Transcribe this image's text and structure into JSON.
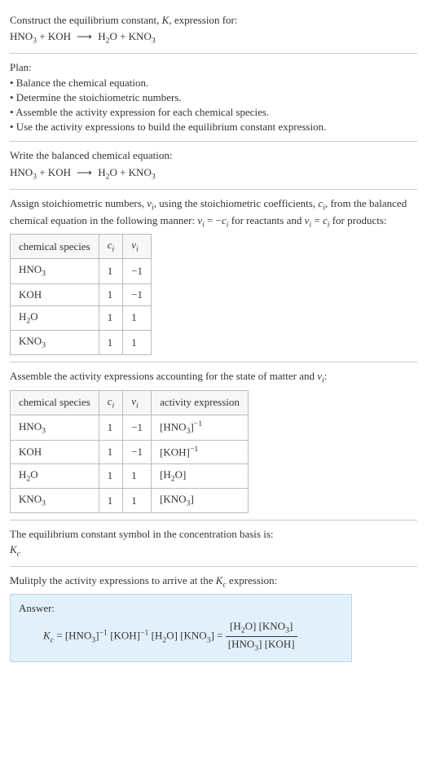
{
  "prompt": {
    "line1_pre": "Construct the equilibrium constant, ",
    "line1_K": "K",
    "line1_post": ", expression for:",
    "eq_lhs1": "HNO",
    "eq_lhs1_sub": "3",
    "eq_plus1": " + KOH ",
    "eq_arrow": "⟶",
    "eq_rhs1": " H",
    "eq_rhs1_sub": "2",
    "eq_rhs2": "O + KNO",
    "eq_rhs2_sub": "3"
  },
  "plan": {
    "title": "Plan:",
    "b1": "• Balance the chemical equation.",
    "b2": "• Determine the stoichiometric numbers.",
    "b3": "• Assemble the activity expression for each chemical species.",
    "b4": "• Use the activity expressions to build the equilibrium constant expression."
  },
  "balanced": {
    "title": "Write the balanced chemical equation:"
  },
  "stoich": {
    "pre": "Assign stoichiometric numbers, ",
    "nu": "ν",
    "nui": "i",
    "mid1": ", using the stoichiometric coefficients, ",
    "c": "c",
    "ci": "i",
    "mid2": ", from the balanced chemical equation in the following manner: ",
    "rel1a": "ν",
    "rel1b": " = −",
    "rel1c": "c",
    "rel1_post": " for reactants and ",
    "rel2a": "ν",
    "rel2b": " = ",
    "rel2c": "c",
    "rel2_post": " for products:",
    "headers": {
      "h1": "chemical species",
      "h2": "cᵢ",
      "h3": "νᵢ"
    },
    "rows": [
      {
        "sp_a": "HNO",
        "sp_sub": "3",
        "ci": "1",
        "nui": "−1"
      },
      {
        "sp_a": "KOH",
        "sp_sub": "",
        "ci": "1",
        "nui": "−1"
      },
      {
        "sp_a": "H",
        "sp_sub": "2",
        "sp_b": "O",
        "ci": "1",
        "nui": "1"
      },
      {
        "sp_a": "KNO",
        "sp_sub": "3",
        "ci": "1",
        "nui": "1"
      }
    ]
  },
  "activity": {
    "title_pre": "Assemble the activity expressions accounting for the state of matter and ",
    "nu": "ν",
    "nui": "i",
    "title_post": ":",
    "headers": {
      "h1": "chemical species",
      "h2": "cᵢ",
      "h3": "νᵢ",
      "h4": "activity expression"
    },
    "rows": [
      {
        "sp_a": "HNO",
        "sp_sub": "3",
        "ci": "1",
        "nui": "−1",
        "act_main": "[HNO",
        "act_sub": "3",
        "act_close": "]",
        "act_sup": "−1"
      },
      {
        "sp_a": "KOH",
        "sp_sub": "",
        "ci": "1",
        "nui": "−1",
        "act_main": "[KOH]",
        "act_sup": "−1"
      },
      {
        "sp_a": "H",
        "sp_sub": "2",
        "sp_b": "O",
        "ci": "1",
        "nui": "1",
        "act_main": "[H",
        "act_sub": "2",
        "act_close": "O]"
      },
      {
        "sp_a": "KNO",
        "sp_sub": "3",
        "ci": "1",
        "nui": "1",
        "act_main": "[KNO",
        "act_sub": "3",
        "act_close": "]"
      }
    ]
  },
  "symbol": {
    "line": "The equilibrium constant symbol in the concentration basis is:",
    "K": "K",
    "c": "c"
  },
  "multiply": {
    "pre": "Mulitply the activity expressions to arrive at the ",
    "K": "K",
    "c": "c",
    "post": " expression:"
  },
  "answer": {
    "label": "Answer:",
    "Kc_K": "K",
    "Kc_c": "c",
    "eq": " = ",
    "t1a": "[HNO",
    "t1sub": "3",
    "t1b": "]",
    "t1sup": "−1",
    "t2": " [KOH]",
    "t2sup": "−1",
    "t3a": " [H",
    "t3sub": "2",
    "t3b": "O]",
    "t4a": " [KNO",
    "t4sub": "3",
    "t4b": "]",
    "eq2": " = ",
    "num_a": "[H",
    "num_asub": "2",
    "num_b": "O] [KNO",
    "num_bsub": "3",
    "num_c": "]",
    "den_a": "[HNO",
    "den_asub": "3",
    "den_b": "] [KOH]"
  }
}
